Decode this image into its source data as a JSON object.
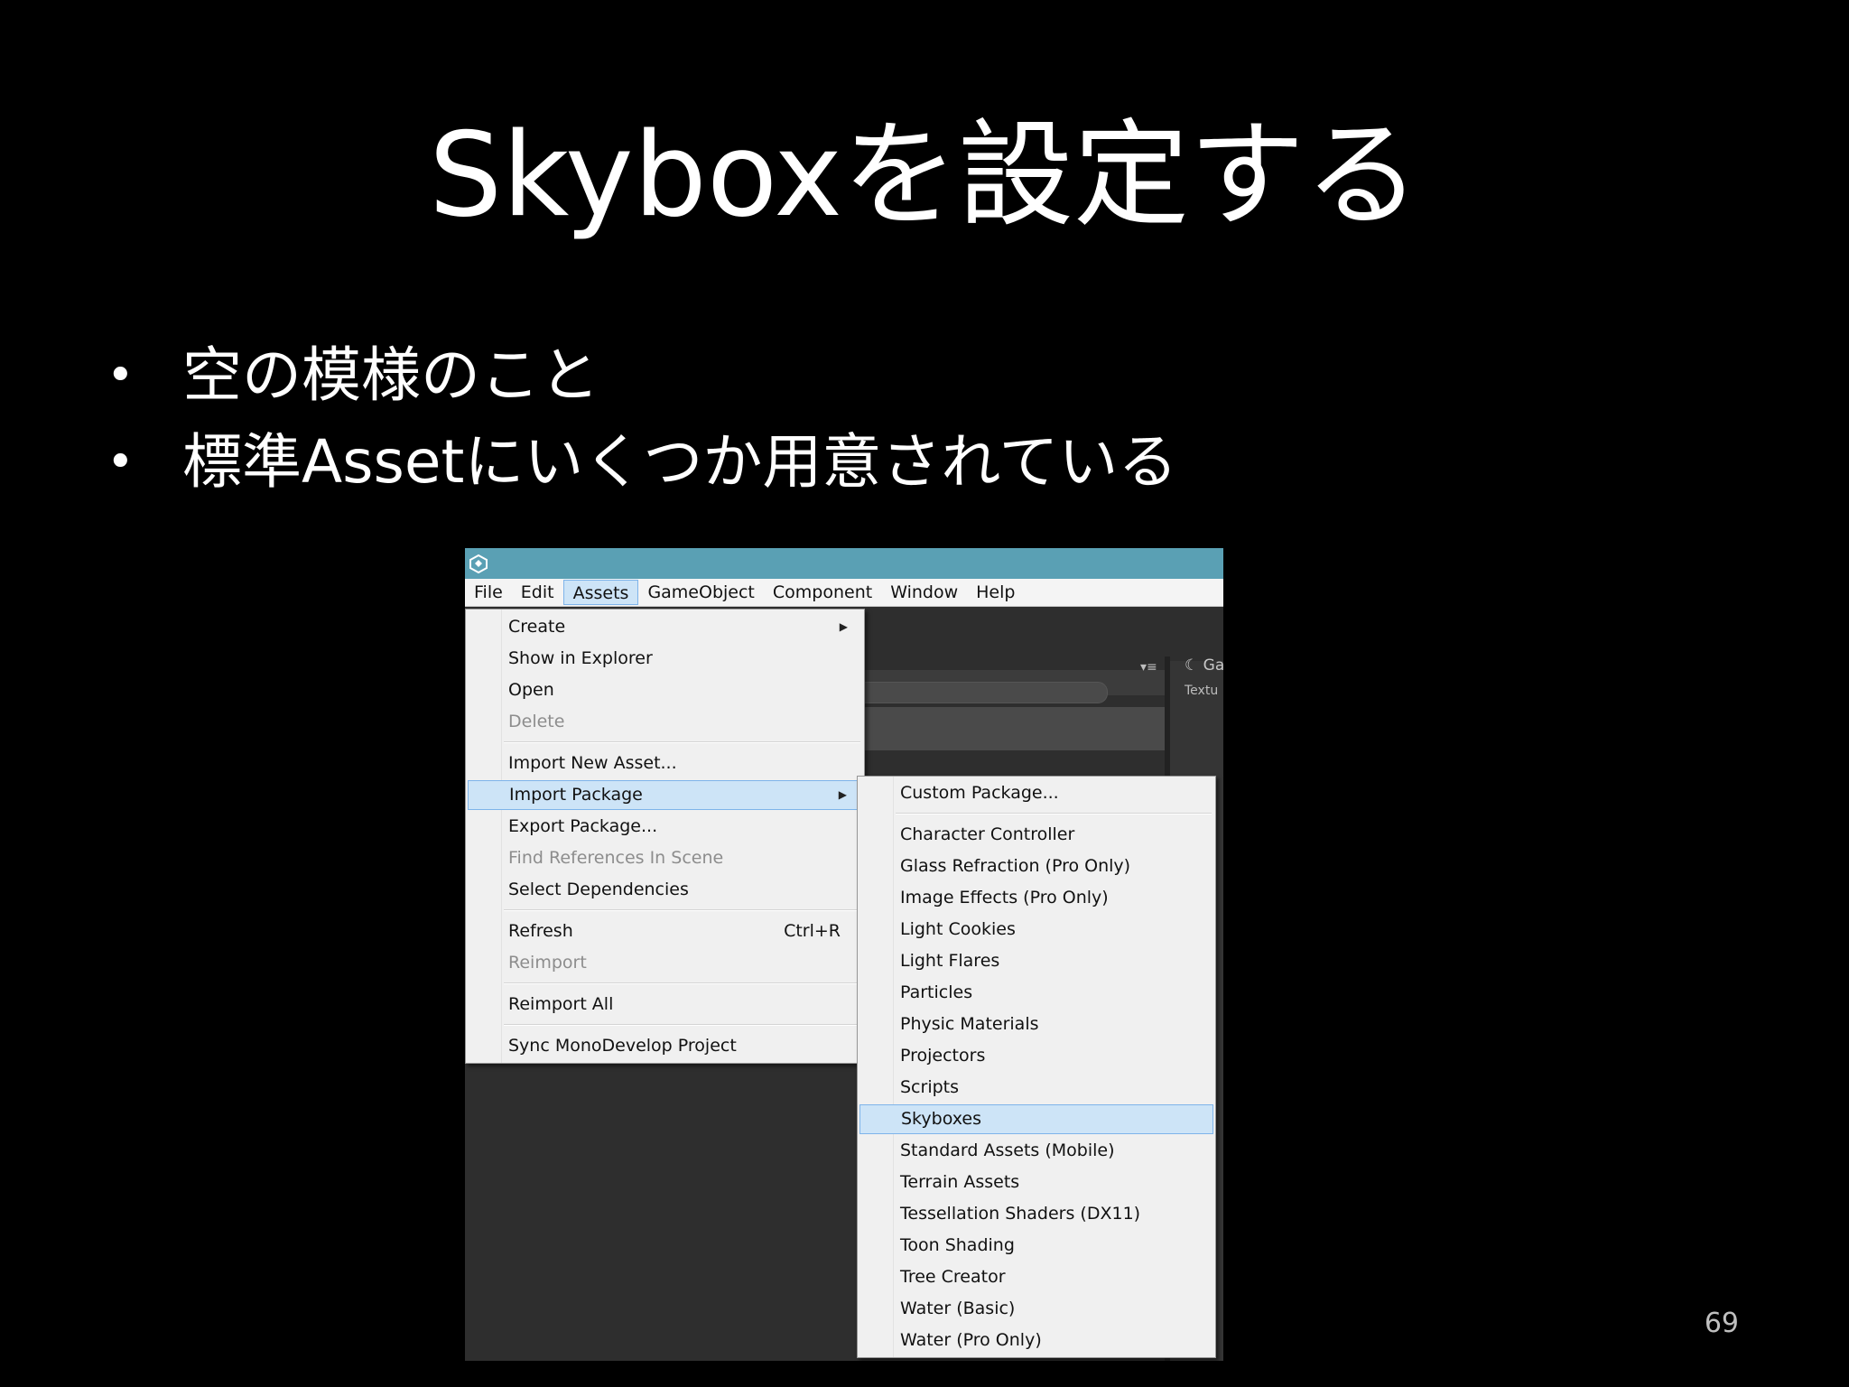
{
  "slide": {
    "title": "Skyboxを設定する",
    "bullets": [
      "空の模様のこと",
      "標準Assetにいくつか用意されている"
    ],
    "page_number": "69"
  },
  "screenshot": {
    "app_icon": "unity-logo-icon",
    "menubar": [
      "File",
      "Edit",
      "Assets",
      "GameObject",
      "Component",
      "Window",
      "Help"
    ],
    "active_menu": "Assets",
    "side_panel": {
      "tab_text": "Ga",
      "sub_text": "Textu"
    },
    "assets_menu": [
      {
        "label": "Create",
        "submenu": true
      },
      {
        "label": "Show in Explorer"
      },
      {
        "label": "Open"
      },
      {
        "label": "Delete",
        "disabled": true
      },
      {
        "label": "Import New Asset..."
      },
      {
        "label": "Import Package",
        "submenu": true,
        "highlighted": true
      },
      {
        "label": "Export Package..."
      },
      {
        "label": "Find References In Scene",
        "disabled": true
      },
      {
        "label": "Select Dependencies"
      },
      {
        "label": "Refresh",
        "shortcut": "Ctrl+R"
      },
      {
        "label": "Reimport",
        "disabled": true
      },
      {
        "label": "Reimport All"
      },
      {
        "label": "Sync MonoDevelop Project"
      }
    ],
    "import_package_submenu": [
      {
        "label": "Custom Package..."
      },
      {
        "label": "Character Controller"
      },
      {
        "label": "Glass Refraction (Pro Only)"
      },
      {
        "label": "Image Effects (Pro Only)"
      },
      {
        "label": "Light Cookies"
      },
      {
        "label": "Light Flares"
      },
      {
        "label": "Particles"
      },
      {
        "label": "Physic Materials"
      },
      {
        "label": "Projectors"
      },
      {
        "label": "Scripts"
      },
      {
        "label": "Skyboxes",
        "highlighted": true
      },
      {
        "label": "Standard Assets (Mobile)"
      },
      {
        "label": "Terrain Assets"
      },
      {
        "label": "Tessellation Shaders (DX11)"
      },
      {
        "label": "Toon Shading"
      },
      {
        "label": "Tree Creator"
      },
      {
        "label": "Water (Basic)"
      },
      {
        "label": "Water (Pro Only)"
      }
    ]
  }
}
